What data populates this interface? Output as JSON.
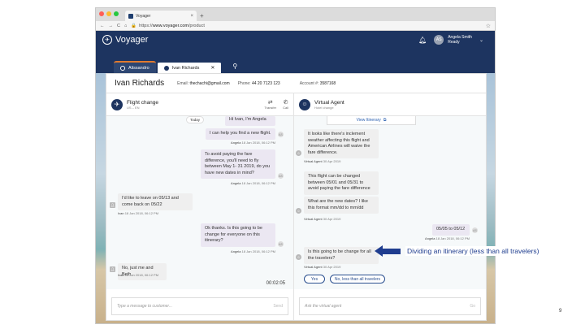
{
  "browser": {
    "tab_title": "Voyager",
    "url_prefix": "https://",
    "url_host": "www.voyager.com",
    "url_path": "/product",
    "colors": {
      "close": "#ff5f57",
      "min": "#febc2e",
      "max": "#28c840"
    }
  },
  "app": {
    "logo_text": "Voyager",
    "user_initials": "AS",
    "user_name": "Angela Smith",
    "user_status": "Ready",
    "brand_color": "#1d3460"
  },
  "customer_tabs": [
    {
      "label": "Alissandro"
    },
    {
      "label": "Ivan Richards"
    }
  ],
  "customer": {
    "name": "Ivan Richards",
    "email_label": "Email:",
    "email": "thechachi@gmail.com",
    "phone_label": "Phone:",
    "phone": "44 20 7123 123",
    "account_label": "Account #:",
    "account": "3587168"
  },
  "left_panel": {
    "title": "Flight change",
    "subtitle": "US – EN",
    "transfer_label": "Transfer",
    "call_label": "Call",
    "today_label": "Today",
    "timer": "00:02:05",
    "compose_placeholder": "Type a message to customer...",
    "send_label": "Send",
    "messages": [
      {
        "text": "Hi Ivan, I'm Angela"
      },
      {
        "text": "I can help you find a new flight.",
        "meta_name": "Angela",
        "meta_time": "18 Jan 2018, 06:12 PM"
      },
      {
        "text": "To avoid paying the fare difference, you'll need to fly between May 1- 31 2019, do you have new dates in mind?",
        "meta_name": "Angela",
        "meta_time": "18 Jan 2018, 06:12 PM"
      },
      {
        "text": "I'd like to leave on 05/13 and come back on 05/22",
        "meta_name": "Ivan",
        "meta_time": "18 Jan 2018, 06:12 PM"
      },
      {
        "text": "Ok thanks. Is this going to be change for everyone on this itinerary?",
        "meta_name": "Angela",
        "meta_time": "18 Jan 2018, 06:12 PM"
      },
      {
        "text": "No, just me and Beth",
        "meta_name": "Ivan",
        "meta_time": "18 Jan 2018, 06:12 PM"
      }
    ],
    "agent_avatar": "AS"
  },
  "right_panel": {
    "title": "Virtual Agent",
    "subtitle": "Hotel change",
    "view_itinerary": "View Itinerary",
    "compose_placeholder": "Ask the virtual agent",
    "go_label": "Go",
    "messages": [
      {
        "text": "It looks like there's inclement weather affecting this flight and American Airlines will waive the fare difference.",
        "meta_name": "Virtual Agent",
        "meta_time": "30 Apr 2019"
      },
      {
        "text": "This flight can be changed between 05/01 and 05/31 to avoid paying the fare difference"
      },
      {
        "text": "What are the new dates? I like this format mm/dd to mm/dd",
        "meta_name": "Virtual Agent",
        "meta_time": "30 Apr 2019"
      },
      {
        "text": "05/05 to 05/12",
        "meta_name": "Angela",
        "meta_time": "18 Jan 2018, 06:12 PM"
      },
      {
        "text": "Is this going to be change for all the travelers?",
        "meta_name": "Virtual Agent",
        "meta_time": "30 Apr 2019"
      }
    ],
    "quick_replies": [
      "Yes",
      "No, less than all travelers"
    ]
  },
  "callout": {
    "text": "Dividing an itinerary (less than all travelers)",
    "color": "#1f3d8f"
  },
  "slide": {
    "page_number": "9"
  }
}
